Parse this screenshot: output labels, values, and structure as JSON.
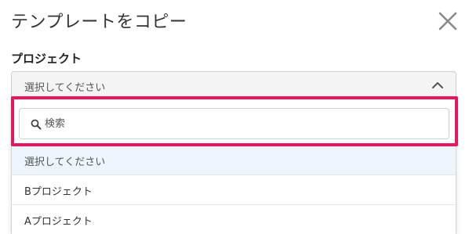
{
  "modal": {
    "title": "テンプレートをコピー",
    "close_icon": "close-icon"
  },
  "project_field": {
    "label": "プロジェクト",
    "selected_value": "選択してください",
    "chevron_icon": "chevron-up-icon"
  },
  "dropdown": {
    "search_placeholder": "検索",
    "search_value": "",
    "search_icon": "search-icon",
    "options": [
      {
        "label": "選択してください",
        "selected": true
      },
      {
        "label": "Bプロジェクト",
        "selected": false
      },
      {
        "label": "Aプロジェクト",
        "selected": false
      }
    ]
  },
  "colors": {
    "highlight": "#e8175d",
    "selected_option_bg": "#eef5fd",
    "select_bg": "#f4f4f4"
  }
}
